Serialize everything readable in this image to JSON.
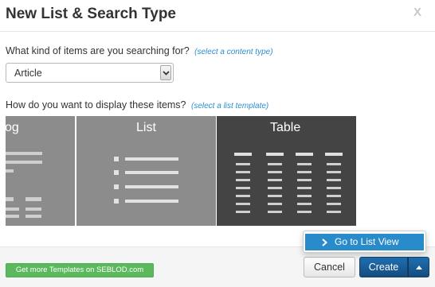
{
  "dialog": {
    "title": "New List & Search Type",
    "close_label": "X"
  },
  "content_type": {
    "question": "What kind of items are you searching for?",
    "hint": "(select a content type)",
    "selected_value": "Article"
  },
  "list_template": {
    "question": "How do you want to display these items?",
    "hint": "(select a list template)",
    "tiles": [
      {
        "label": "og",
        "icon": "blog-layout-icon",
        "selected": false
      },
      {
        "label": "List",
        "icon": "list-layout-icon",
        "selected": false
      },
      {
        "label": "Table",
        "icon": "table-layout-icon",
        "selected": true
      }
    ]
  },
  "footer": {
    "seblod_label": "Get more Templates on SEBLOD.com",
    "cancel_label": "Cancel",
    "create_label": "Create",
    "dropdown_items": [
      {
        "label": "Go to List View",
        "icon": "chevron-right-icon"
      }
    ]
  },
  "colors": {
    "accent": "#2a8bcb",
    "primary_button": "#1a5f9a",
    "success_button": "#5cb85c",
    "tile_default": "#8c8c8c",
    "tile_selected": "#444444"
  }
}
